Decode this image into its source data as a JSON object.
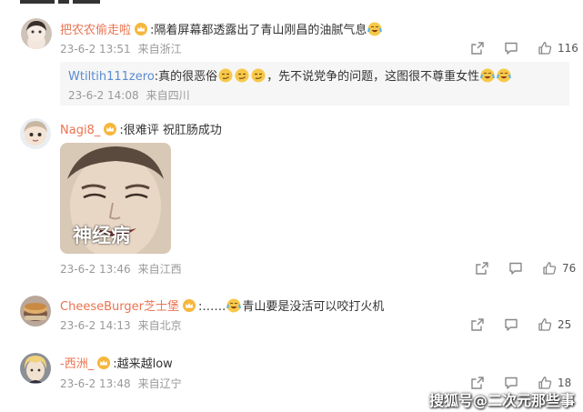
{
  "comments": [
    {
      "name": "把农农偷走啦",
      "text": ":隔着屏幕都透露出了青山刚昌的油腻气息",
      "date": "23-6-2 13:51",
      "location": "来自浙江",
      "likes": "116",
      "reply": {
        "name": "Wtiltih111zero",
        "text_a": ":真的很恶俗",
        "text_b": "，先不说党争的问题，这图很不尊重女性",
        "date": "23-6-2 14:08",
        "location": "来自四川"
      }
    },
    {
      "name": "Nagi8_",
      "text": ":很难评 祝肛肠成功",
      "sticker_caption": "神经病",
      "date": "23-6-2 13:46",
      "location": "来自江西",
      "likes": "76"
    },
    {
      "name": "CheeseBurger芝士堡",
      "text_a": ":……",
      "text_b": "青山要是没活可以咬打火机",
      "date": "23-6-2 14:13",
      "location": "来自北京",
      "likes": "25"
    },
    {
      "name": "-西洲_",
      "text": ":越来越low",
      "date": "23-6-2 13:48",
      "location": "来自辽宁",
      "likes": "18"
    }
  ],
  "watermark": "搜狐号@二次元那些事",
  "colors": {
    "name": "#eb7350",
    "reply_name": "#5b8bd1",
    "meta": "#999999",
    "reply_bg": "#f6f6f6"
  },
  "icons": [
    "share-icon",
    "comment-icon",
    "like-icon",
    "crown-badge-icon",
    "crying-laughing-emoji",
    "smirk-emoji"
  ]
}
